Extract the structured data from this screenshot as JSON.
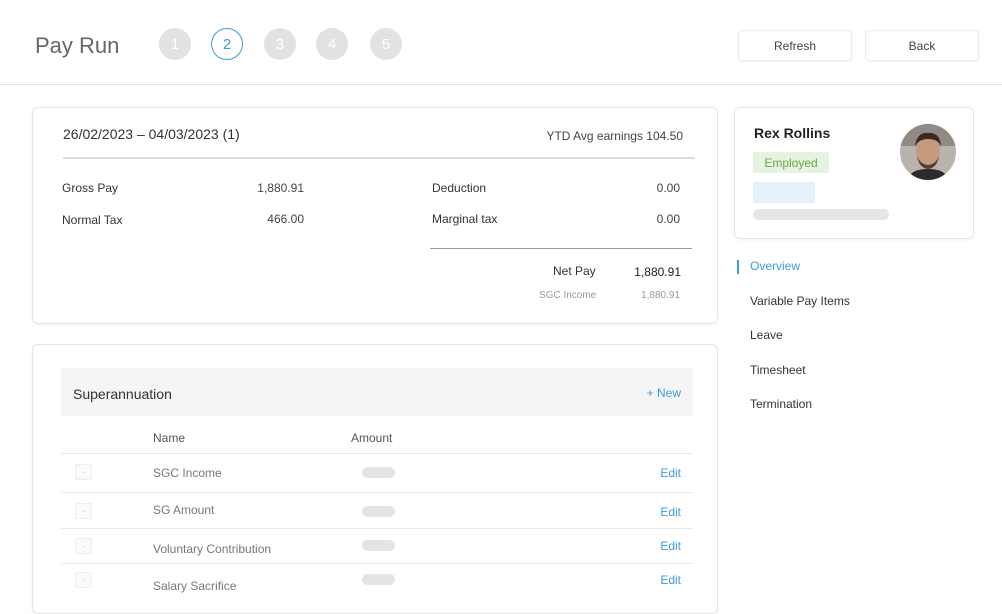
{
  "header": {
    "title": "Pay Run",
    "steps": [
      "1",
      "2",
      "3",
      "4",
      "5"
    ],
    "active_step": 2,
    "refresh_label": "Refresh",
    "back_label": "Back"
  },
  "summary": {
    "period": "26/02/2023 – 04/03/2023 (1)",
    "ytd": "YTD Avg earnings 104.50",
    "gross_pay_label": "Gross Pay",
    "gross_pay_value": "1,880.91",
    "normal_tax_label": "Normal Tax",
    "normal_tax_value": "466.00",
    "deduction_label": "Deduction",
    "deduction_value": "0.00",
    "marginal_tax_label": "Marginal tax",
    "marginal_tax_value": "0.00",
    "net_pay_label": "Net Pay",
    "net_pay_value": "1,880.91",
    "sgc_income_label": "SGC Income",
    "sgc_income_value": "1,880.91"
  },
  "superannuation": {
    "title": "Superannuation",
    "new_label": "+ New",
    "col_name": "Name",
    "col_amount": "Amount",
    "rows": [
      {
        "marker": "·",
        "name": "SGC Income",
        "action": "Edit"
      },
      {
        "marker": "·",
        "name": "SG Amount",
        "action": "Edit"
      },
      {
        "marker": "·",
        "name": "Voluntary Contribution",
        "action": "Edit"
      },
      {
        "marker": "·",
        "name": "Salary Sacrifice",
        "action": "Edit"
      }
    ]
  },
  "employee": {
    "name": "Rex Rollins",
    "status": "Employed",
    "status_color": "#6aa64a"
  },
  "side_nav": {
    "items": [
      "Overview",
      "Variable Pay Items",
      "Leave",
      "Timesheet",
      "Termination"
    ],
    "active": "Overview"
  },
  "colors": {
    "accent": "#3d9be0",
    "step_inactive": "#e2e2e2"
  }
}
